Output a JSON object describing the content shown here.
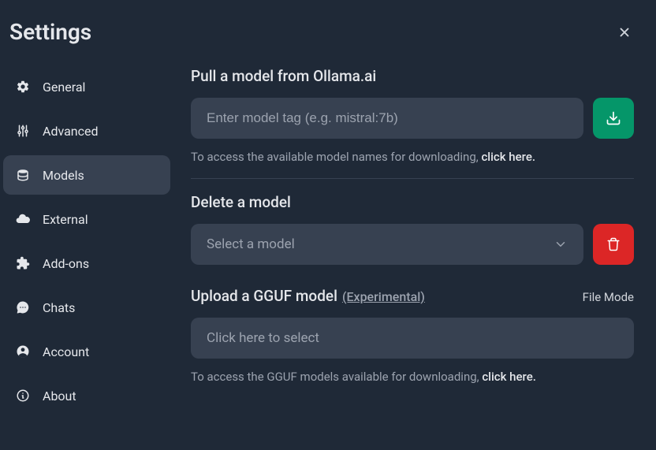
{
  "header": {
    "title": "Settings"
  },
  "sidebar": {
    "items": [
      {
        "label": "General"
      },
      {
        "label": "Advanced"
      },
      {
        "label": "Models"
      },
      {
        "label": "External"
      },
      {
        "label": "Add-ons"
      },
      {
        "label": "Chats"
      },
      {
        "label": "Account"
      },
      {
        "label": "About"
      }
    ]
  },
  "main": {
    "pull": {
      "title": "Pull a model from Ollama.ai",
      "placeholder": "Enter model tag (e.g. mistral:7b)",
      "helper_prefix": "To access the available model names for downloading, ",
      "helper_link": "click here."
    },
    "delete": {
      "title": "Delete a model",
      "select_placeholder": "Select a model"
    },
    "upload": {
      "title": "Upload a GGUF model",
      "experimental": "(Experimental)",
      "file_mode": "File Mode",
      "drop_text": "Click here to select",
      "helper_prefix": "To access the GGUF models available for downloading, ",
      "helper_link": "click here."
    }
  }
}
